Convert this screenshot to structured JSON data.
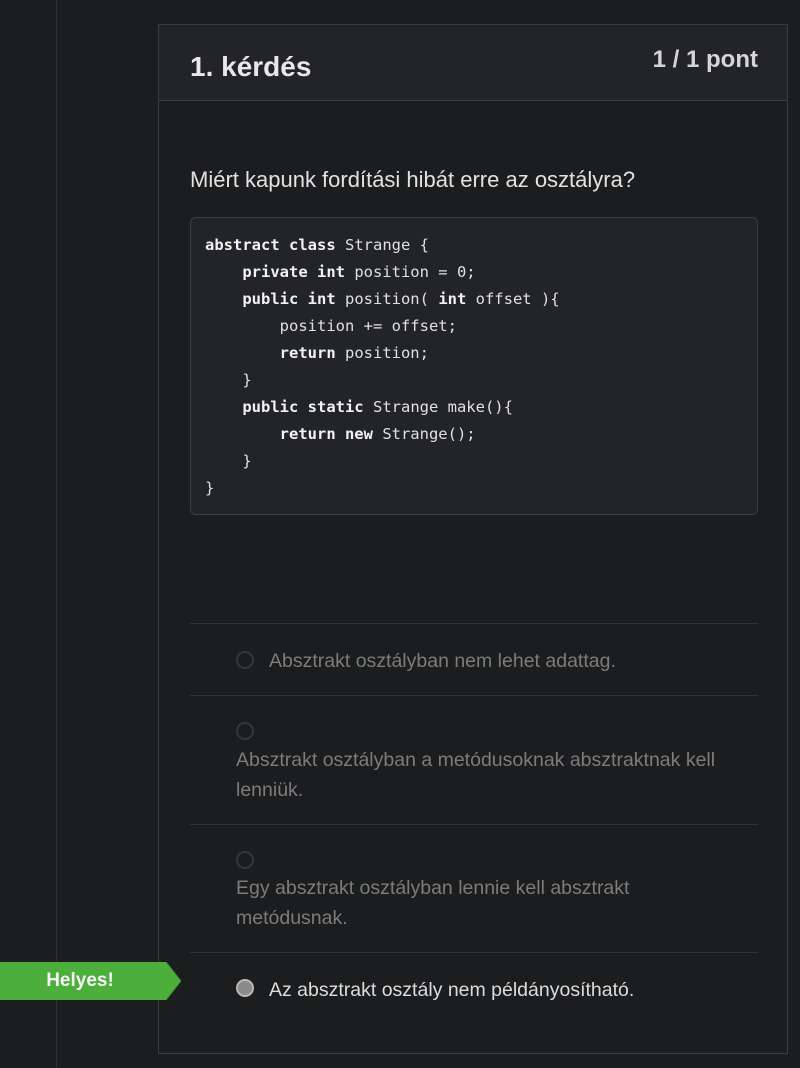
{
  "question": {
    "title": "1. kérdés",
    "points": "1 / 1 pont",
    "text": "Miért kapunk fordítási hibát erre az osztályra?"
  },
  "code": [
    [
      {
        "t": "abstract class",
        "k": true
      },
      {
        "t": " Strange {",
        "k": false
      }
    ],
    [
      {
        "t": "    ",
        "k": false
      },
      {
        "t": "private int",
        "k": true
      },
      {
        "t": " position = 0;",
        "k": false
      }
    ],
    [
      {
        "t": "    ",
        "k": false
      },
      {
        "t": "public int",
        "k": true
      },
      {
        "t": " position( ",
        "k": false
      },
      {
        "t": "int",
        "k": true
      },
      {
        "t": " offset ){",
        "k": false
      }
    ],
    [
      {
        "t": "        position += offset;",
        "k": false
      }
    ],
    [
      {
        "t": "        ",
        "k": false
      },
      {
        "t": "return",
        "k": true
      },
      {
        "t": " position;",
        "k": false
      }
    ],
    [
      {
        "t": "    }",
        "k": false
      }
    ],
    [
      {
        "t": "    ",
        "k": false
      },
      {
        "t": "public static",
        "k": true
      },
      {
        "t": " Strange make(){",
        "k": false
      }
    ],
    [
      {
        "t": "        ",
        "k": false
      },
      {
        "t": "return new",
        "k": true
      },
      {
        "t": " Strange();",
        "k": false
      }
    ],
    [
      {
        "t": "    }",
        "k": false
      }
    ],
    [
      {
        "t": "}",
        "k": false
      }
    ]
  ],
  "answers": [
    {
      "label": "Absztrakt osztályban nem lehet adattag.",
      "selected": false
    },
    {
      "label": "Absztrakt osztályban a metódusoknak absztraktnak kell lenniük.",
      "selected": false
    },
    {
      "label": "Egy absztrakt osztályban lennie kell absztrakt metódusnak.",
      "selected": false
    },
    {
      "label": "Az absztrakt osztály nem példányosítható.",
      "selected": true
    }
  ],
  "correct_flag": "Helyes!",
  "colors": {
    "background": "#1c1d1f",
    "flag_green": "#4caf3c",
    "border": "#3b3d40"
  }
}
